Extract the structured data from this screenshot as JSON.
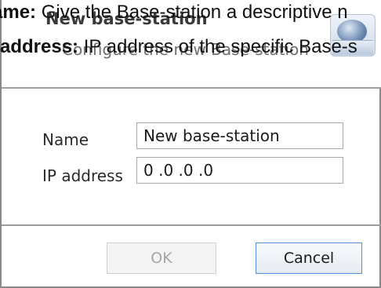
{
  "dialog": {
    "title": "New base-station",
    "subtitle": "Configure the new Base-station",
    "icon": "base-station-icon"
  },
  "captions": [
    {
      "lead": "ame:",
      "text": " Give the Base-station a descriptive n"
    },
    {
      "lead": "address:",
      "text": " IP address of the specific Base-s"
    }
  ],
  "form": {
    "name_label": "Name",
    "name_value": "New base-station",
    "ip_label": "IP address",
    "ip_value": "0 .0 .0 .0"
  },
  "buttons": {
    "ok_label": "OK",
    "ok_enabled": false,
    "cancel_label": "Cancel"
  },
  "colors": {
    "focus_border": "#4f8fd6",
    "disabled_text": "#a6a6a6"
  }
}
